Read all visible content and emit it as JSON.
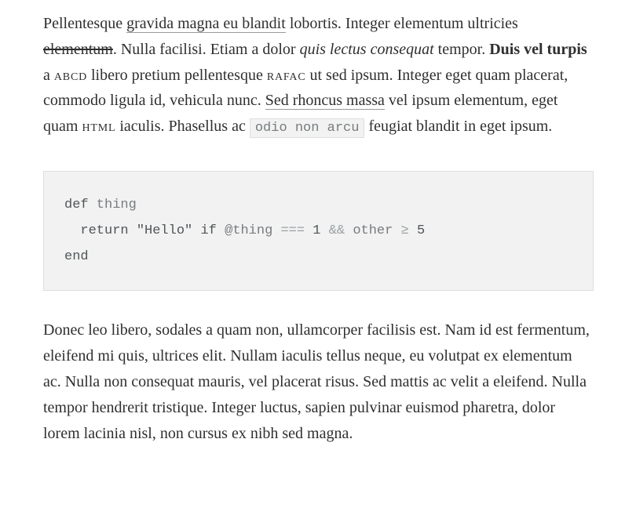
{
  "paragraph1": {
    "t1": "Pellentesque ",
    "link1": "gravida magna eu blandit",
    "t2": " lobortis. Integer elementum ultricies ",
    "strike1": "elementum",
    "t3": ". Nulla facilisi. Etiam a dolor ",
    "em1": "quis lectus consequat",
    "t4": " tempor. ",
    "strong1": "Duis vel turpis",
    "t5": " a ",
    "sc1": "abcd",
    "t6": " libero pretium pellentesque ",
    "sc2": "rafac",
    "t7": " ut sed ipsum. Integer eget quam placerat, commodo ligula id, vehicula nunc. ",
    "link2": "Sed rhoncus massa",
    "t8": " vel ipsum elementum, eget quam ",
    "sc3": "html",
    "t9": " iaculis. Phasellus ac ",
    "code1": "odio non arcu",
    "t10": " feugiat blandit in eget ipsum."
  },
  "code": {
    "l1_kw": "def",
    "l1_name": " thing",
    "indent2": "  ",
    "l2_kw": "return",
    "l2_sp1": " ",
    "l2_str": "\"Hello\"",
    "l2_sp2": " ",
    "l2_if": "if",
    "l2_sp3": " ",
    "l2_at": "@thing",
    "l2_sp4": " ",
    "l2_eq": "===",
    "l2_sp5": " ",
    "l2_n1": "1",
    "l2_sp6": " ",
    "l2_and": "&&",
    "l2_sp7": " ",
    "l2_other": "other",
    "l2_sp8": " ",
    "l2_ge": "≥",
    "l2_sp9": " ",
    "l2_n5": "5",
    "l3_end": "end"
  },
  "paragraph2": {
    "text": "Donec leo libero, sodales a quam non, ullamcorper facilisis est. Nam id est fermentum, eleifend mi quis, ultrices elit. Nullam iaculis tellus neque, eu volutpat ex elementum ac. Nulla non consequat mauris, vel placerat risus. Sed mattis ac velit a eleifend. Nulla tempor hendrerit tristique. Integer luctus, sapien pulvinar euismod pharetra, dolor lorem lacinia nisl, non cursus ex nibh sed magna."
  }
}
